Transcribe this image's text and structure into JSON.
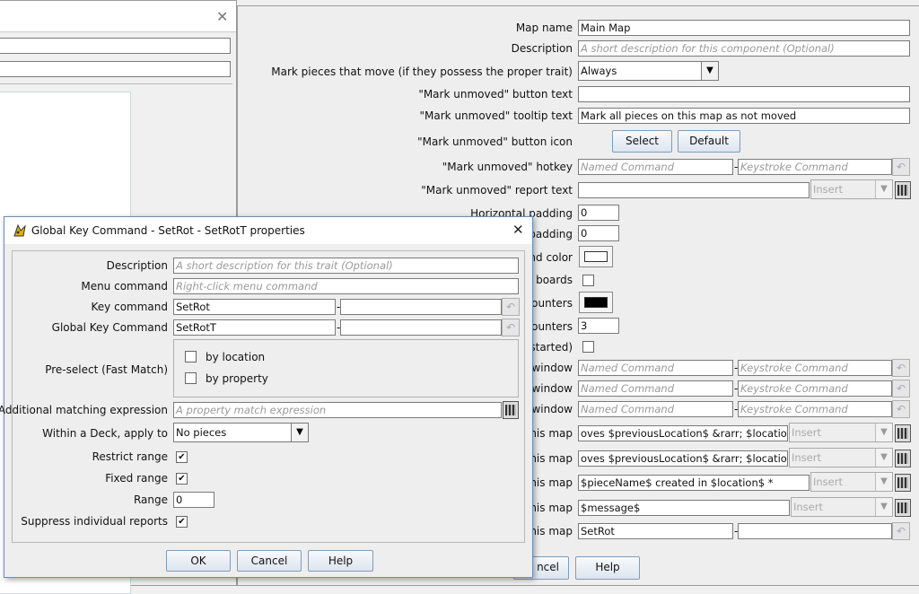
{
  "map_editor": {
    "fields": [
      {
        "label": "Map name",
        "value": "Main Map",
        "placeholder": ""
      },
      {
        "label": "Description",
        "value": "",
        "placeholder": "A short description for this component (Optional)"
      },
      {
        "label": "Mark pieces that move (if they possess the proper trait)",
        "value": "Always"
      },
      {
        "label": "\"Mark unmoved\" button text",
        "value": ""
      },
      {
        "label": "\"Mark unmoved\" tooltip text",
        "value": "Mark all pieces on this map as not moved"
      },
      {
        "label": "\"Mark unmoved\" button icon",
        "select_label": "Select",
        "default_label": "Default"
      },
      {
        "label": "\"Mark unmoved\" hotkey",
        "named_placeholder": "Named Command",
        "keystroke_placeholder": "Keystroke Command"
      },
      {
        "label": "\"Mark unmoved\" report text",
        "insert_label": "Insert"
      },
      {
        "label": "Horizontal padding",
        "value": "0"
      },
      {
        "label": "padding",
        "value": "0"
      },
      {
        "label": "nd color",
        "color": "#ffffff"
      },
      {
        "label": "e boards"
      },
      {
        "label": "counters",
        "color": "#000000"
      },
      {
        "label": "counters",
        "value": "3"
      },
      {
        "label": "estarted)"
      },
      {
        "label": "window",
        "named_placeholder": "Named Command",
        "keystroke_placeholder": "Keystroke Command"
      },
      {
        "label": "window",
        "named_placeholder": "Named Command",
        "keystroke_placeholder": "Keystroke Command"
      },
      {
        "label": "window",
        "named_placeholder": "Named Command",
        "keystroke_placeholder": "Keystroke Command"
      },
      {
        "label": "his map",
        "value": "oves $previousLocation$ &rarr; $location$ *",
        "insert_label": "Insert"
      },
      {
        "label": "his map",
        "value": "oves $previousLocation$ &rarr; $location$ *",
        "insert_label": "Insert"
      },
      {
        "label": "his map",
        "value": "$pieceName$ created in $location$ *",
        "insert_label": "Insert"
      },
      {
        "label": "his map",
        "value": "$message$",
        "insert_label": "Insert"
      },
      {
        "label": "his map",
        "value": "SetRot",
        "keystroke_value": ""
      }
    ],
    "bottom_buttons": {
      "cancel_label": "ncel",
      "help_label": "Help"
    }
  },
  "dialog": {
    "title": "Global Key Command - SetRot - SetRotT properties",
    "close_glyph": "✕",
    "description": {
      "label": "Description",
      "placeholder": "A short description for this trait (Optional)"
    },
    "menu_command": {
      "label": "Menu command",
      "placeholder": "Right-click menu command"
    },
    "key_command": {
      "label": "Key command",
      "value": "SetRot",
      "keystroke": ""
    },
    "global_key_command": {
      "label": "Global Key Command",
      "value": "SetRotT",
      "keystroke": ""
    },
    "preselect": {
      "label": "Pre-select (Fast Match)",
      "by_location": "by location",
      "by_property": "by property"
    },
    "additional_matching": {
      "label": "Additional matching expression",
      "placeholder": "A property match expression"
    },
    "within_deck": {
      "label": "Within a Deck, apply to",
      "value": "No pieces"
    },
    "restrict_range": {
      "label": "Restrict range",
      "checked": "✔"
    },
    "fixed_range": {
      "label": "Fixed range",
      "checked": "✔"
    },
    "range": {
      "label": "Range",
      "value": "0"
    },
    "suppress_reports": {
      "label": "Suppress individual reports",
      "checked": "✔"
    },
    "buttons": {
      "ok": "OK",
      "cancel": "Cancel",
      "help": "Help"
    }
  },
  "dash": "-",
  "colors": {
    "field_border": "#7a7a7a",
    "button_border": "#7f9db9",
    "placeholder": "#9a9a9a"
  }
}
